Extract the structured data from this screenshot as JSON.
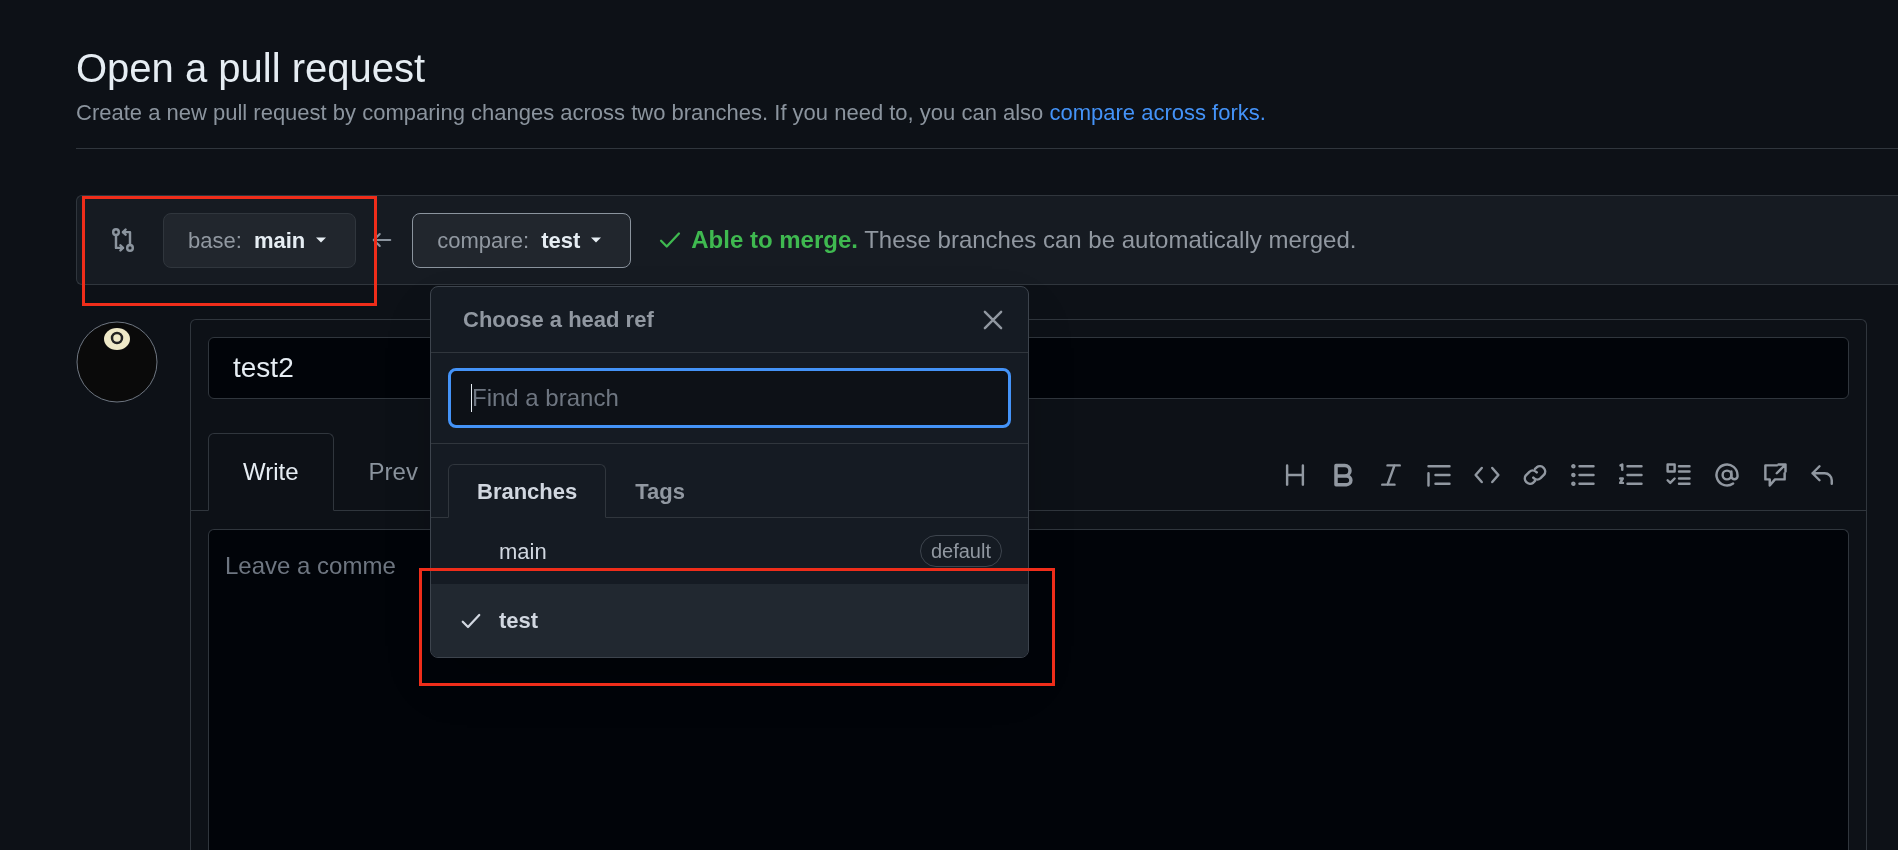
{
  "page": {
    "title": "Open a pull request",
    "description": "Create a new pull request by comparing changes across two branches. If you need to, you can also",
    "description_link": "compare across forks."
  },
  "compare_bar": {
    "base_button": {
      "label": "base:",
      "branch": "main"
    },
    "compare_button": {
      "label": "compare:",
      "branch": "test"
    },
    "merge_status": {
      "headline": "Able to merge.",
      "detail": "These branches can be automatically merged."
    }
  },
  "editor": {
    "title_value": "test2",
    "tabs": [
      {
        "label": "Write",
        "selected": true
      },
      {
        "label": "Prev",
        "selected": false
      }
    ],
    "comment_placeholder": "Leave a comme"
  },
  "branch_menu": {
    "title": "Choose a head ref",
    "search_placeholder": "Find a branch",
    "tabs": [
      {
        "label": "Branches",
        "selected": true
      },
      {
        "label": "Tags",
        "selected": false
      }
    ],
    "branches": [
      {
        "name": "main",
        "badge": "default",
        "selected": false
      },
      {
        "name": "test",
        "selected": true
      }
    ]
  }
}
